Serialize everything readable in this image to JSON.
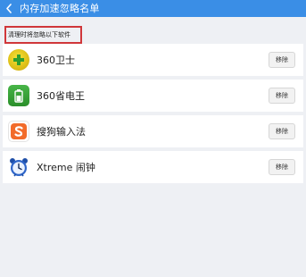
{
  "header": {
    "title": "内存加速忽略名单"
  },
  "hint": {
    "text": "清理时将忽略以下软件"
  },
  "apps": [
    {
      "name": "360卫士",
      "icon": "360-guard-icon",
      "remove_label": "移除"
    },
    {
      "name": "360省电王",
      "icon": "battery-saver-icon",
      "remove_label": "移除"
    },
    {
      "name": "搜狗输入法",
      "icon": "sogou-input-icon",
      "remove_label": "移除"
    },
    {
      "name": "Xtreme 闹钟",
      "icon": "alarm-clock-icon",
      "remove_label": "移除"
    }
  ],
  "colors": {
    "header": "#3a8ee6",
    "highlight_border": "#d0373a",
    "background": "#eef0f4"
  }
}
